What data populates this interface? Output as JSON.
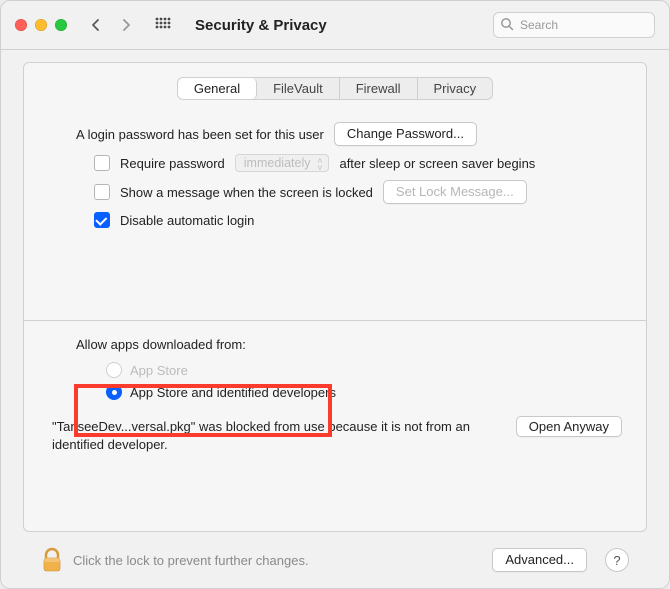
{
  "window": {
    "title": "Security & Privacy"
  },
  "search": {
    "placeholder": "Search"
  },
  "tabs": {
    "general": "General",
    "filevault": "FileVault",
    "firewall": "Firewall",
    "privacy": "Privacy"
  },
  "general": {
    "login_password_label": "A login password has been set for this user",
    "change_password_btn": "Change Password...",
    "require_password_label": "Require password",
    "require_password_delay": "immediately",
    "require_password_suffix": "after sleep or screen saver begins",
    "show_message_label": "Show a message when the screen is locked",
    "set_lock_message_btn": "Set Lock Message...",
    "disable_auto_login_label": "Disable automatic login"
  },
  "gatekeeper": {
    "allow_label": "Allow apps downloaded from:",
    "option_app_store": "App Store",
    "option_identified": "App Store and identified developers",
    "blocked_text": "\"TanseeDev...versal.pkg\" was blocked from use because it is not from an identified developer.",
    "open_anyway_btn": "Open Anyway"
  },
  "footer": {
    "lock_text": "Click the lock to prevent further changes.",
    "advanced_btn": "Advanced...",
    "help_btn": "?"
  }
}
